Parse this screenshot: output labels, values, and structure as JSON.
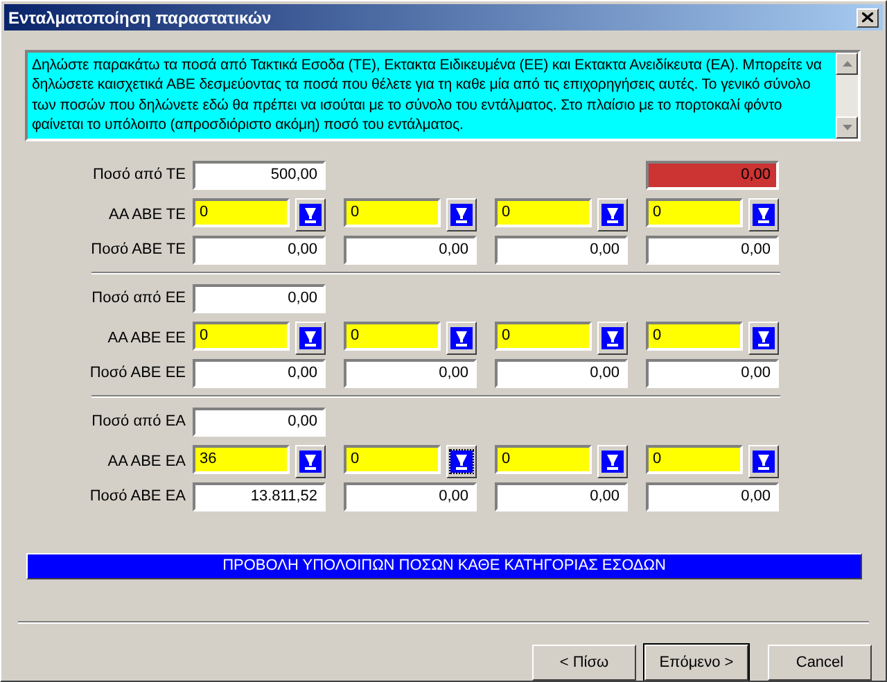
{
  "window": {
    "title": "Ενταλματοποίηση παραστατικών"
  },
  "info_text": "Δηλώστε παρακάτω τα ποσά από Τακτικά Εσοδα (ΤΕ), Εκτακτα Ειδικευμένα (ΕΕ) και Εκτακτα Ανειδίκευτα (ΕΑ). Μπορείτε να δηλώσετε καισχετικά ΑΒΕ δεσμεύοντας τα ποσά που θέλετε για τη καθε μία από τις επιχορηγήσεις αυτές. Το γενικό σύνολο των ποσών που δηλώνετε εδώ θα πρέπει να ισούται με το σύνολο του εντάλματος. Στο πλαίσιο με το πορτοκαλί φόντο φαίνεται το υπόλοιπο (απροσδιόριστο ακόμη) ποσό του εντάλματος.",
  "remainder": "0,00",
  "groups": [
    {
      "total_label": "Ποσό από ΤΕ",
      "total_value": "500,00",
      "code_label": "ΑΑ ΑΒΕ ΤΕ",
      "amount_label": "Ποσό ΑΒΕ ΤΕ",
      "slots": [
        {
          "code": "0",
          "amount": "0,00",
          "focused": false
        },
        {
          "code": "0",
          "amount": "0,00",
          "focused": false
        },
        {
          "code": "0",
          "amount": "0,00",
          "focused": false
        },
        {
          "code": "0",
          "amount": "0,00",
          "focused": false
        }
      ]
    },
    {
      "total_label": "Ποσό από ΕΕ",
      "total_value": "0,00",
      "code_label": "ΑΑ ΑΒΕ ΕΕ",
      "amount_label": "Ποσό ΑΒΕ ΕΕ",
      "slots": [
        {
          "code": "0",
          "amount": "0,00",
          "focused": false
        },
        {
          "code": "0",
          "amount": "0,00",
          "focused": false
        },
        {
          "code": "0",
          "amount": "0,00",
          "focused": false
        },
        {
          "code": "0",
          "amount": "0,00",
          "focused": false
        }
      ]
    },
    {
      "total_label": "Ποσό από ΕΑ",
      "total_value": "0,00",
      "code_label": "ΑΑ ΑΒΕ ΕΑ",
      "amount_label": "Ποσό ΑΒΕ ΕΑ",
      "slots": [
        {
          "code": "36",
          "amount": "13.811,52",
          "focused": false
        },
        {
          "code": "0",
          "amount": "0,00",
          "focused": true
        },
        {
          "code": "0",
          "amount": "0,00",
          "focused": false
        },
        {
          "code": "0",
          "amount": "0,00",
          "focused": false
        }
      ]
    }
  ],
  "summary_button": "ΠΡΟΒΟΛΗ ΥΠΟΛΟΙΠΩΝ ΠΟΣΩΝ ΚΑΘΕ ΚΑΤΗΓΟΡΙΑΣ ΕΣΟΔΩΝ",
  "buttons": [
    {
      "label": "< Πίσω",
      "default": false
    },
    {
      "label": "Επόμενο >",
      "default": true
    },
    {
      "label": "Cancel",
      "default": false
    }
  ]
}
